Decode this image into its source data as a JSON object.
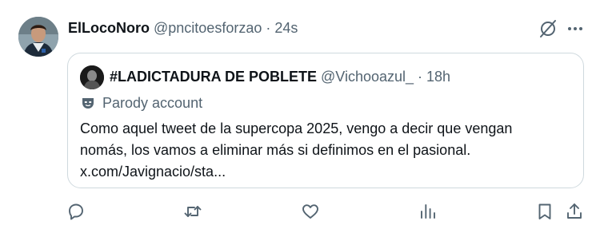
{
  "tweet": {
    "author_name": "ElLocoNoro",
    "author_handle": "@pncitoesforzao",
    "separator": "·",
    "time": "24s"
  },
  "quoted": {
    "author_name": "#LADICTADURA DE POBLETE",
    "author_handle": "@Vichooazul_",
    "separator": "·",
    "time": "18h",
    "label": "Parody account",
    "text_lines": [
      "Como aquel tweet de la supercopa 2025, vengo a decir que vengan",
      "nomás, los vamos a eliminar más si definimos en el pasional.",
      "x.com/Javignacio/sta..."
    ]
  },
  "icons": {
    "header": [
      "grok-icon",
      "more-icon"
    ],
    "actions": [
      "reply-icon",
      "retweet-icon",
      "like-icon",
      "views-icon",
      "bookmark-icon",
      "share-icon"
    ]
  },
  "colors": {
    "text": "#0f1419",
    "secondary": "#536471",
    "border": "#cfd9de"
  }
}
